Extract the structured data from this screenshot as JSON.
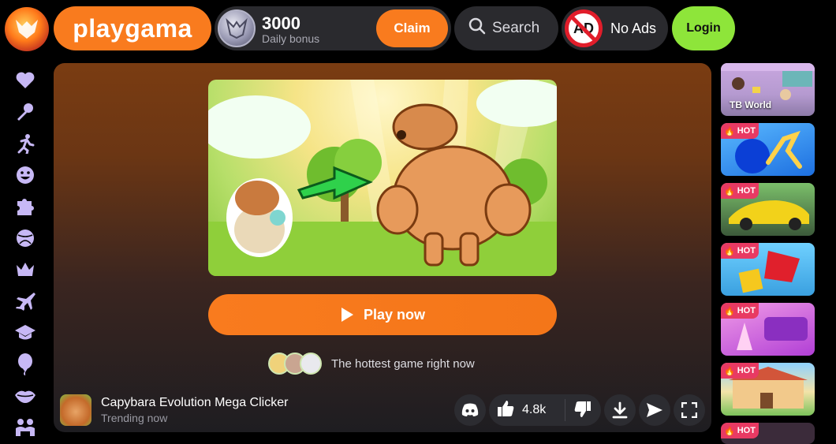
{
  "header": {
    "brand": "playgama",
    "bonus_amount": "3000",
    "bonus_label": "Daily bonus",
    "claim_label": "Claim",
    "search_label": "Search",
    "noads_label": "No Ads",
    "noads_badge": "AD",
    "login_label": "Login"
  },
  "sidebar": {
    "items": [
      {
        "icon": "heart-icon"
      },
      {
        "icon": "microphone-icon"
      },
      {
        "icon": "running-icon"
      },
      {
        "icon": "smiley-icon"
      },
      {
        "icon": "puzzle-icon"
      },
      {
        "icon": "ball-icon"
      },
      {
        "icon": "crown-icon"
      },
      {
        "icon": "plane-icon"
      },
      {
        "icon": "graduation-cap-icon"
      },
      {
        "icon": "balloon-icon"
      },
      {
        "icon": "lips-icon"
      },
      {
        "icon": "people-icon"
      }
    ]
  },
  "main": {
    "play_label": "Play now",
    "hot_text": "The hottest game right now",
    "game_title": "Capybara Evolution Mega Clicker",
    "game_subtitle": "Trending now",
    "likes": "4.8k"
  },
  "rail": {
    "cards": [
      {
        "label": "TB World",
        "hot": false
      },
      {
        "label": "",
        "hot": true
      },
      {
        "label": "",
        "hot": true
      },
      {
        "label": "",
        "hot": true
      },
      {
        "label": "",
        "hot": true
      },
      {
        "label": "",
        "hot": true
      }
    ],
    "hot_label": "HOT"
  },
  "colors": {
    "accent": "#f97b1e",
    "login": "#8ee53a",
    "sidebar_icon": "#c7b8f5",
    "hot_badge": "#e83a63"
  }
}
